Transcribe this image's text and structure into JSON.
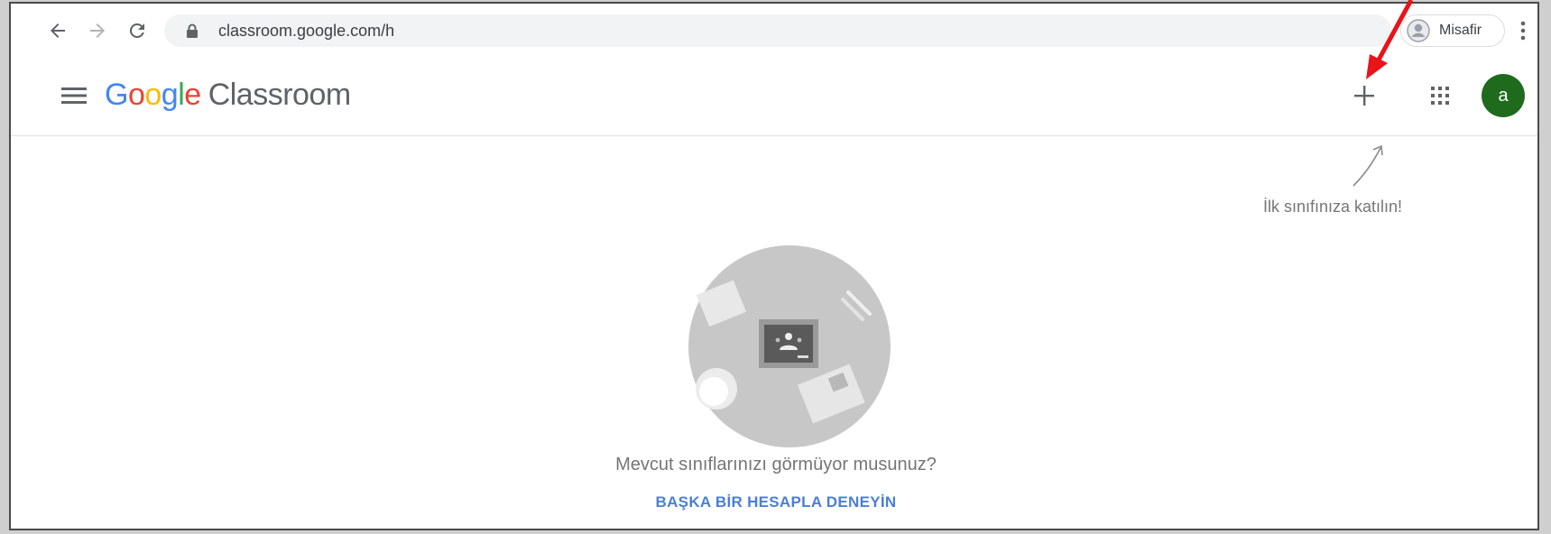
{
  "browser": {
    "url": "classroom.google.com/h",
    "profile_label": "Misafir"
  },
  "appbar": {
    "logo_brand": "Google",
    "logo_product": "Classroom",
    "avatar_letter": "a"
  },
  "hint": {
    "text": "İlk sınıfınıza katılın!"
  },
  "empty_state": {
    "message": "Mevcut sınıflarınızı görmüyor musunuz?",
    "link": "BAŞKA BİR HESAPLA DENEYİN"
  },
  "colors": {
    "avatar": "#1e6b1e",
    "link": "#4a7fd6",
    "annotation_arrow": "#e8141a"
  }
}
